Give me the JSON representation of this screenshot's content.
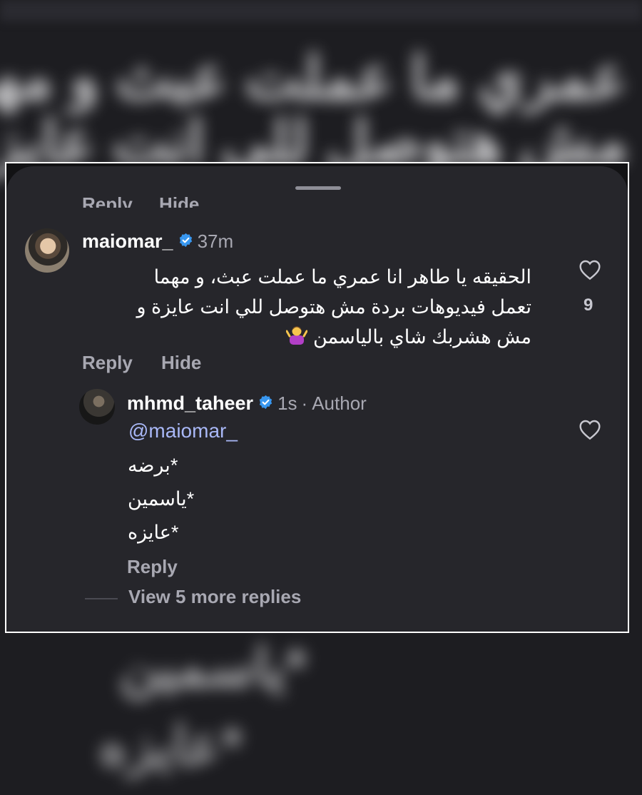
{
  "background": {
    "blurred_lines": [
      "عمري ما عملت عبث و مهما",
      "مش هتوصل للي انت عايزة",
      "*ياسمين",
      "*عايزه"
    ]
  },
  "sheet": {
    "cut_off_actions": [
      "Reply",
      "Hide"
    ]
  },
  "comment": {
    "username": "maiomar_",
    "verified": true,
    "time": "37m",
    "text_lines": [
      "الحقيقه يا طاهر انا عمري ما عملت عبث، و مهما",
      "تعمل فيديوهات بردة مش هتوصل للي انت عايزة و",
      "مش هشربك شاي بالياسمن"
    ],
    "emoji": "person-shrugging",
    "like_count": "9",
    "actions": {
      "reply": "Reply",
      "hide": "Hide"
    }
  },
  "reply": {
    "username": "mhmd_taheer",
    "verified": true,
    "time": "1s",
    "separator": "·",
    "badge": "Author",
    "mention": "@maiomar_",
    "lines": [
      "*برضه",
      "*ياسمين",
      "*عايزه"
    ],
    "actions": {
      "reply": "Reply"
    }
  },
  "view_more": "View 5 more replies",
  "colors": {
    "sheet": "#26262b",
    "text": "#ffffff",
    "muted": "#a8a8b2",
    "mention": "#a9b8f7",
    "verified": "#3897f0"
  }
}
